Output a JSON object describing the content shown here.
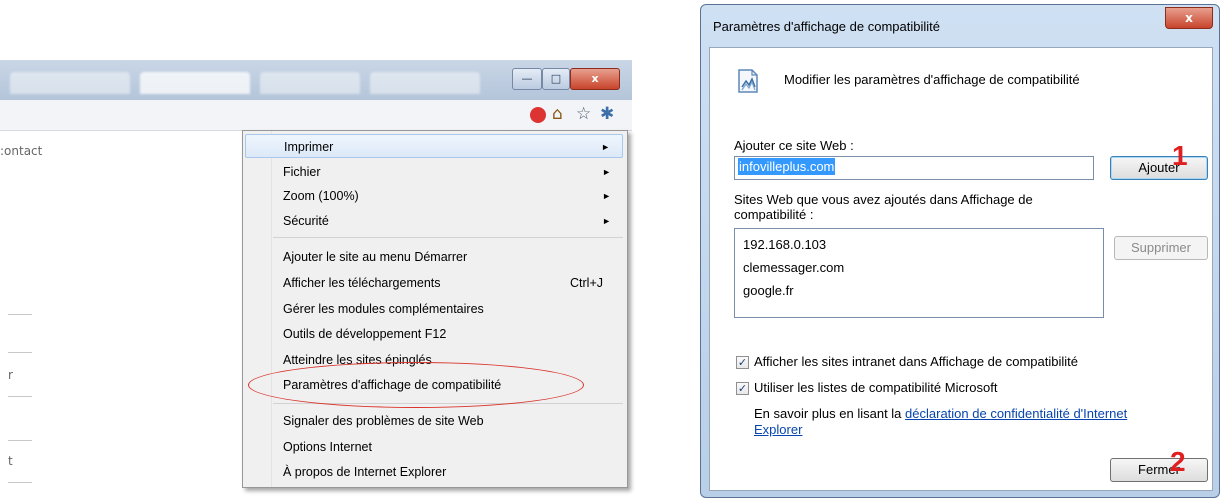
{
  "browser": {
    "page_text": ":ontact",
    "side_chars": [
      "r",
      "t"
    ],
    "window_controls": {
      "minimize": "—",
      "maximize": "□",
      "close": "x"
    },
    "toolbar_icons": {
      "home": "⌂",
      "favorites": "☆",
      "tools": "✱"
    }
  },
  "menu": {
    "items": [
      {
        "label": "Imprimer",
        "submenu": true,
        "highlighted": true
      },
      {
        "label": "Fichier",
        "submenu": true
      },
      {
        "label": "Zoom (100%)",
        "submenu": true
      },
      {
        "label": "Sécurité",
        "submenu": true
      },
      {
        "label": "Ajouter le site au menu Démarrer"
      },
      {
        "label": "Afficher les téléchargements",
        "shortcut": "Ctrl+J"
      },
      {
        "label": "Gérer les modules complémentaires"
      },
      {
        "label": "Outils de développement F12"
      },
      {
        "label": "Atteindre les sites épinglés"
      },
      {
        "label": "Paramètres d'affichage de compatibilité",
        "circled": true
      },
      {
        "label": "Signaler des problèmes de site Web"
      },
      {
        "label": "Options Internet"
      },
      {
        "label": "À propos de Internet Explorer"
      }
    ],
    "arrow": "►"
  },
  "dialog": {
    "title": "Paramètres d'affichage de compatibilité",
    "close": "x",
    "heading": "Modifier les paramètres d'affichage de compatibilité",
    "add_label": "Ajouter ce site Web :",
    "add_value": "infovilleplus.com",
    "add_button": "Ajouter",
    "list_label": "Sites Web que vous avez ajoutés dans Affichage de compatibilité :",
    "sites": [
      "192.168.0.103",
      "clemessager.com",
      "google.fr"
    ],
    "remove_button": "Supprimer",
    "intranet_checkbox": {
      "label": "Afficher les sites intranet dans Affichage de compatibilité",
      "checked": true
    },
    "microsoft_lists_checkbox": {
      "label": "Utiliser les listes de compatibilité Microsoft",
      "checked": true
    },
    "info_text": "En savoir plus en lisant la",
    "link_text": "déclaration de confidentialité d'Internet Explorer",
    "close_button": "Fermer"
  },
  "annotations": {
    "step1": "1",
    "step2": "2"
  },
  "colors": {
    "accent_red": "#e02020",
    "selection_blue": "#3399ff",
    "link": "#0645ad"
  }
}
